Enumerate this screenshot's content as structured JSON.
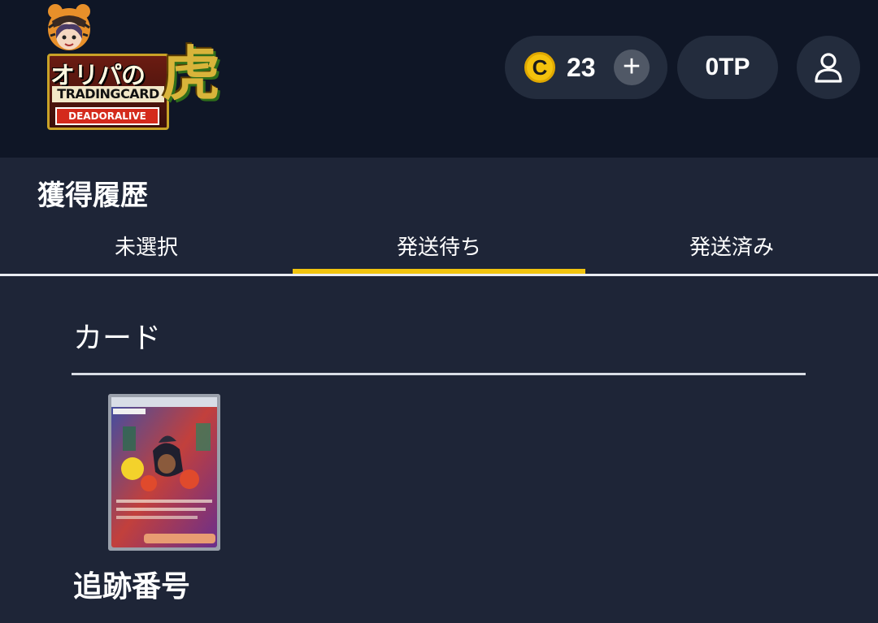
{
  "header": {
    "logo": {
      "title": "オリパの",
      "subtitle": "TRADINGCARD",
      "band": "DEADORALIVE",
      "kanji": "虎"
    },
    "coins": {
      "icon_letter": "C",
      "value": "23",
      "add_label": "+"
    },
    "tp": {
      "value": "0TP"
    },
    "user_icon": "user-icon"
  },
  "page": {
    "title": "獲得履歴",
    "tabs": [
      {
        "label": "未選択",
        "active": false
      },
      {
        "label": "発送待ち",
        "active": true
      },
      {
        "label": "発送済み",
        "active": false
      }
    ],
    "section_heading": "カード",
    "tracking_label": "追跡番号"
  },
  "colors": {
    "header_bg": "#0f1626",
    "page_bg": "#1e2537",
    "pill_bg": "#232c3d",
    "accent": "#f1c40f",
    "coin": "#f4c20d"
  }
}
